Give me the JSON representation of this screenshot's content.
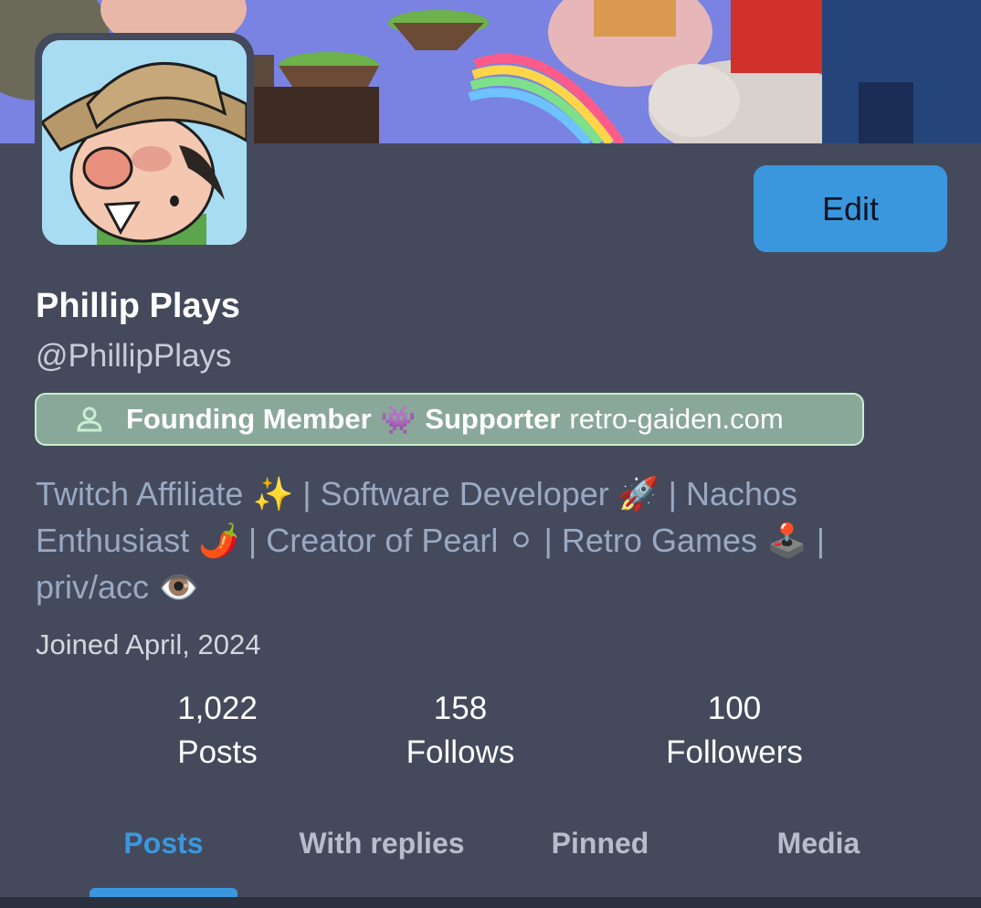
{
  "profile": {
    "display_name": "Phillip Plays",
    "handle": "@PhillipPlays",
    "edit_label": "Edit",
    "badge": {
      "icon": "person-icon",
      "part1": "Founding Member",
      "emoji": "👾",
      "part2": "Supporter",
      "domain": "retro-gaiden.com"
    },
    "bio": "Twitch Affiliate ✨ | Software Developer 🚀 | Nachos Enthusiast 🌶️ | Creator of Pearl ⚪ | Retro Games 🕹️ | priv/acc 👁️",
    "joined": "Joined April, 2024"
  },
  "stats": [
    {
      "value": "1,022",
      "label": "Posts"
    },
    {
      "value": "158",
      "label": "Follows"
    },
    {
      "value": "100",
      "label": "Followers"
    }
  ],
  "tabs": [
    "Posts",
    "With replies",
    "Pinned",
    "Media"
  ],
  "colors": {
    "background": "#444a5c",
    "accent": "#3b97dd",
    "badge_bg": "#8aa89a",
    "badge_border": "#c8efcf",
    "bio_text": "#9aa9c3"
  }
}
